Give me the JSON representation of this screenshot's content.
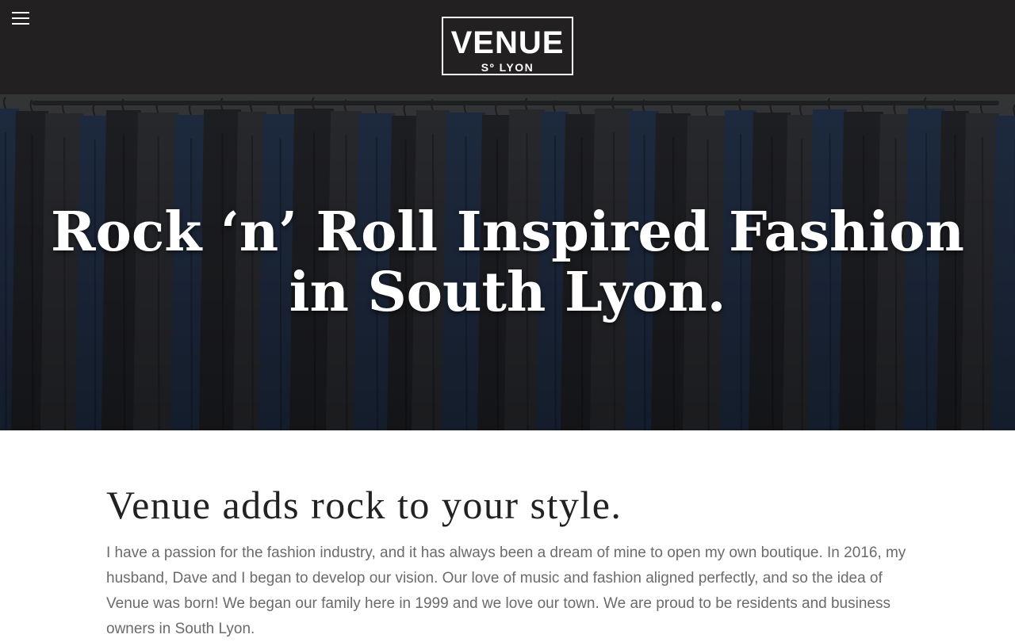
{
  "header": {
    "logo": {
      "main": "VENUE",
      "sub": "Sº LYON"
    },
    "menu_icon": "hamburger-menu-icon"
  },
  "hero": {
    "title_line1": "Rock ‘n’ Roll Inspired Fashion",
    "title_line2": "in South Lyon."
  },
  "intro": {
    "heading": "Venue adds rock to your style.",
    "body": "I have a passion for the fashion industry, and it has always been a dream of mine to open my own boutique. In 2016, my husband, Dave and I began to develop our vision. Our love of music and fashion aligned perfectly, and so the idea of Venue was born!  We began our family here in 1999 and we love our town. We are proud to be residents and business owners in South Lyon."
  },
  "colors": {
    "header_bg": "#222021",
    "body_text": "#6b6b6b",
    "heading_text": "#222222"
  }
}
